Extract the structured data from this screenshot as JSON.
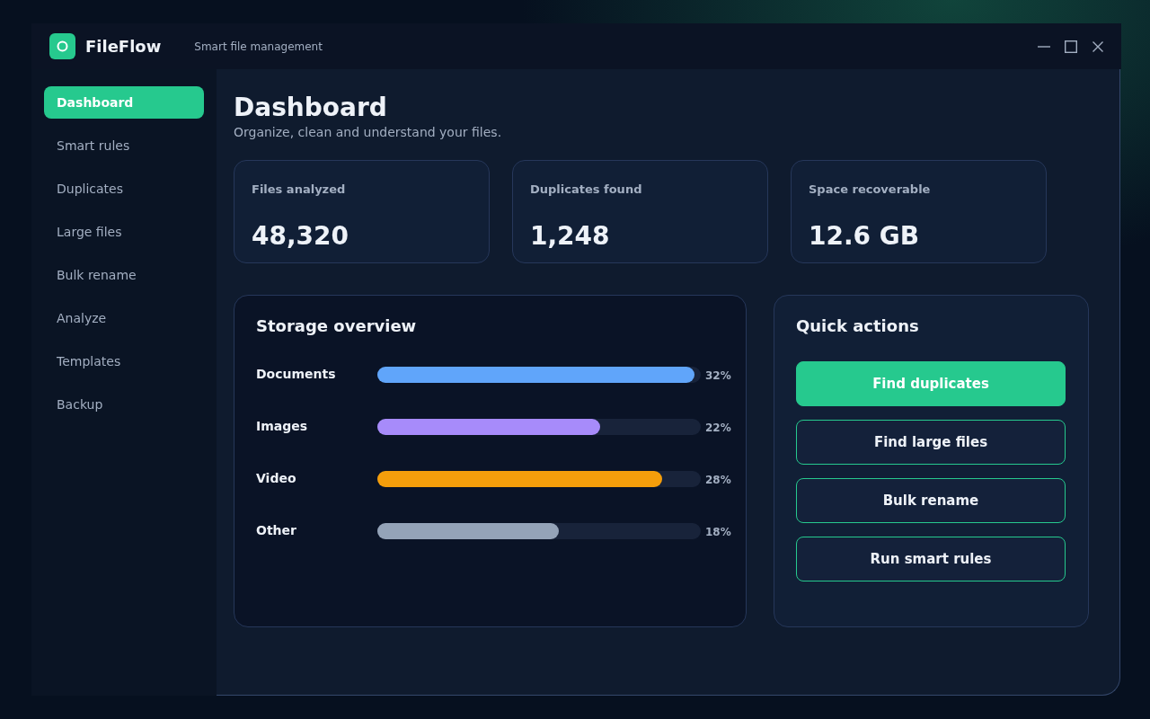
{
  "app": {
    "name": "FileFlow",
    "tagline": "Smart file management"
  },
  "sidebar": {
    "items": [
      {
        "label": "Dashboard",
        "selected": true
      },
      {
        "label": "Smart rules",
        "selected": false
      },
      {
        "label": "Duplicates",
        "selected": false
      },
      {
        "label": "Large files",
        "selected": false
      },
      {
        "label": "Bulk rename",
        "selected": false
      },
      {
        "label": "Analyze",
        "selected": false
      },
      {
        "label": "Templates",
        "selected": false
      },
      {
        "label": "Backup",
        "selected": false
      }
    ]
  },
  "header": {
    "title": "Dashboard",
    "subtitle": "Organize, clean and understand your files."
  },
  "stats": [
    {
      "label": "Files analyzed",
      "value": "48,320"
    },
    {
      "label": "Duplicates found",
      "value": "1,248"
    },
    {
      "label": "Space recoverable",
      "value": "12.6 GB"
    }
  ],
  "storage": {
    "title": "Storage overview",
    "rows": [
      {
        "label": "Documents",
        "level": 0.98,
        "reading": "32%",
        "color": "#60a5fa"
      },
      {
        "label": "Images",
        "level": 0.69,
        "reading": "22%",
        "color": "#a78bfa"
      },
      {
        "label": "Video",
        "level": 0.88,
        "reading": "28%",
        "color": "#f59e0b"
      },
      {
        "label": "Other",
        "level": 0.56,
        "reading": "18%",
        "color": "#94a3b8"
      }
    ]
  },
  "quick_actions": {
    "title": "Quick actions",
    "buttons": [
      {
        "label": "Find duplicates",
        "kind": "primary"
      },
      {
        "label": "Find large files",
        "kind": "outline"
      },
      {
        "label": "Bulk rename",
        "kind": "outline"
      },
      {
        "label": "Run smart rules",
        "kind": "outline"
      }
    ]
  }
}
